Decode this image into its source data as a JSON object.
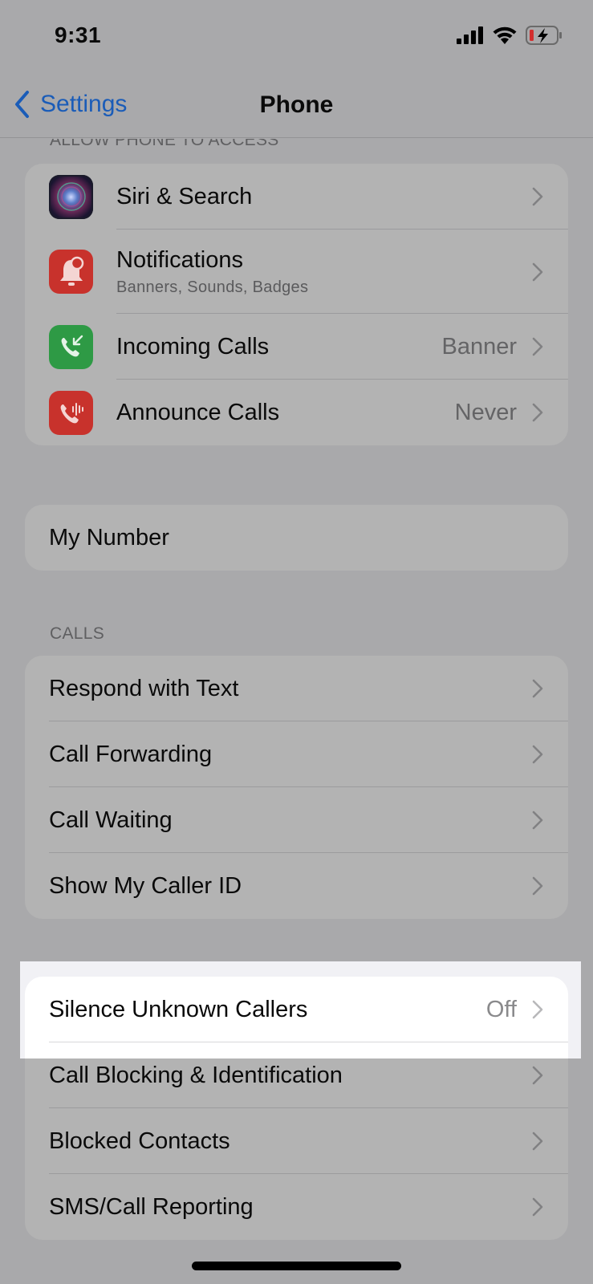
{
  "status_bar": {
    "time": "9:31",
    "icons": [
      "cellular-signal-icon",
      "wifi-icon",
      "battery-charging-low-icon"
    ],
    "battery_color": "#d32f2f"
  },
  "nav": {
    "back_label": "Settings",
    "title": "Phone",
    "accent_color": "#1a5cb8"
  },
  "sections": {
    "allow_access": {
      "header": "ALLOW PHONE TO ACCESS",
      "rows": [
        {
          "label": "Siri & Search",
          "icon": "siri-icon"
        },
        {
          "label": "Notifications",
          "sublabel": "Banners, Sounds, Badges",
          "icon": "notifications-bell-icon",
          "icon_color": "#c8322c"
        },
        {
          "label": "Incoming Calls",
          "value": "Banner",
          "icon": "incoming-call-icon",
          "icon_color": "#2e9a45"
        },
        {
          "label": "Announce Calls",
          "value": "Never",
          "icon": "announce-call-icon",
          "icon_color": "#c8322c"
        }
      ]
    },
    "my_number": {
      "rows": [
        {
          "label": "My Number"
        }
      ]
    },
    "calls": {
      "header": "CALLS",
      "rows": [
        {
          "label": "Respond with Text"
        },
        {
          "label": "Call Forwarding"
        },
        {
          "label": "Call Waiting"
        },
        {
          "label": "Show My Caller ID"
        }
      ]
    },
    "blocking": {
      "rows": [
        {
          "label": "Silence Unknown Callers",
          "value": "Off",
          "highlighted": true
        },
        {
          "label": "Call Blocking & Identification"
        },
        {
          "label": "Blocked Contacts"
        },
        {
          "label": "SMS/Call Reporting"
        }
      ]
    }
  }
}
